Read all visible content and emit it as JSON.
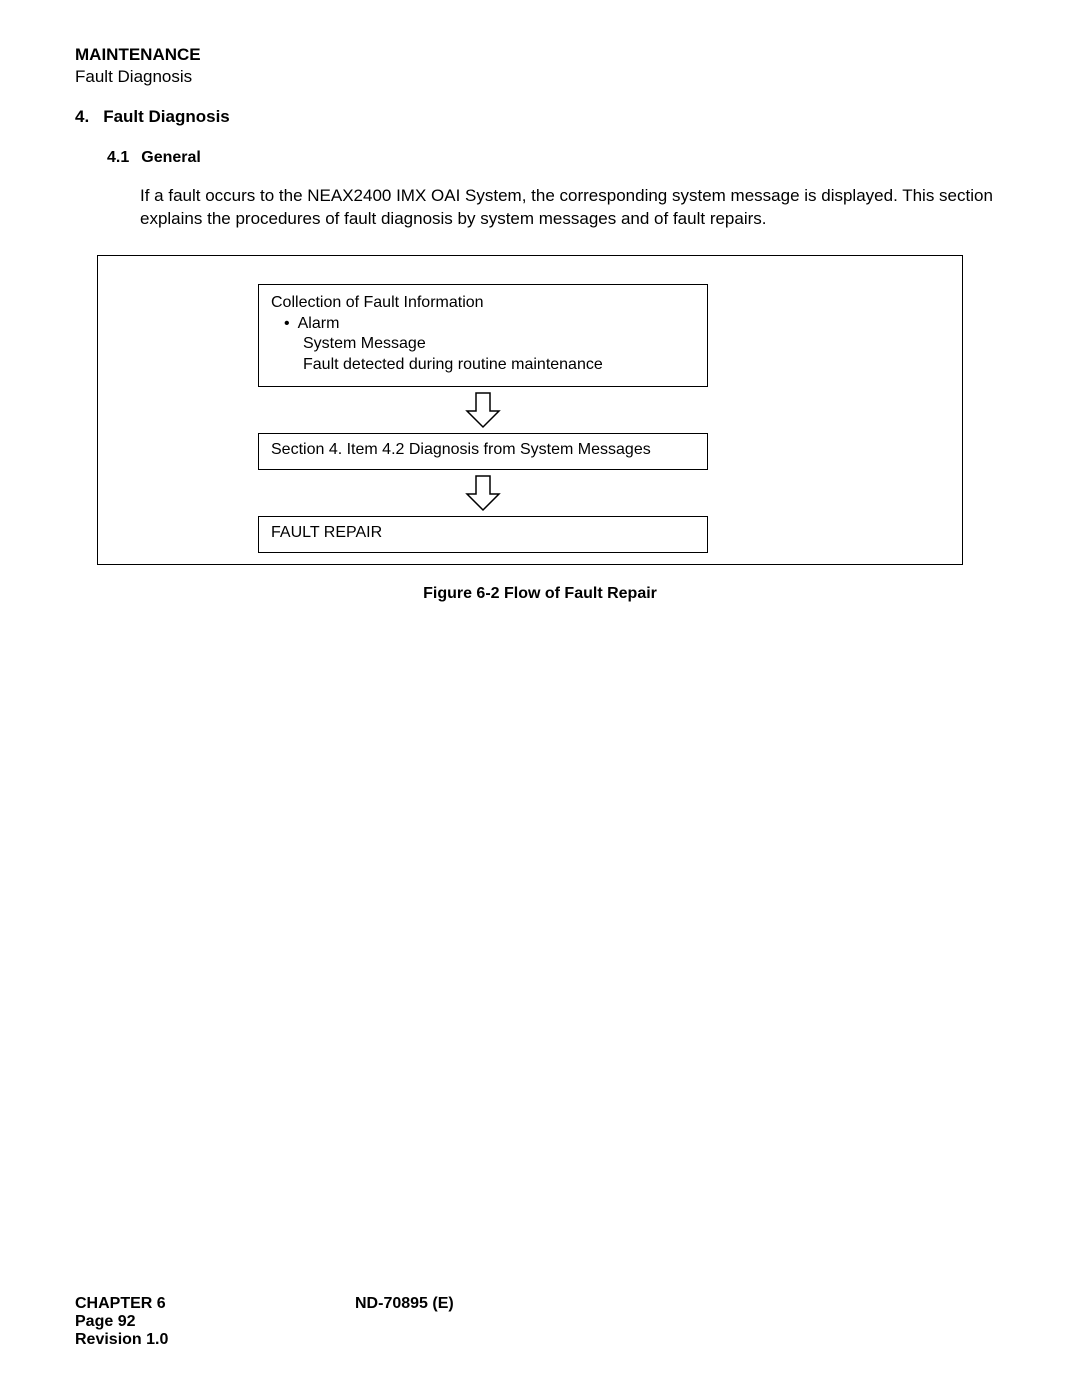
{
  "header": {
    "title": "MAINTENANCE",
    "subtitle": "Fault Diagnosis"
  },
  "section": {
    "num": "4.",
    "title": "Fault Diagnosis"
  },
  "subsection": {
    "num": "4.1",
    "title": "General"
  },
  "paragraph": "If a fault occurs to the NEAX2400 IMX OAI System, the corresponding system message is displayed. This section explains the procedures of fault diagnosis by system messages and of fault repairs.",
  "box1": {
    "title": "Collection of Fault Information",
    "bullet": "Alarm",
    "line2": "System Message",
    "line3": "Fault detected during routine maintenance"
  },
  "box2": "Section 4.  Item 4.2  Diagnosis from System Messages",
  "box3": "FAULT REPAIR",
  "caption": "Figure 6-2   Flow of Fault Repair",
  "footer": {
    "chapter": "CHAPTER 6",
    "doc": "ND-70895 (E)",
    "page": "Page 92",
    "rev": "Revision 1.0"
  }
}
